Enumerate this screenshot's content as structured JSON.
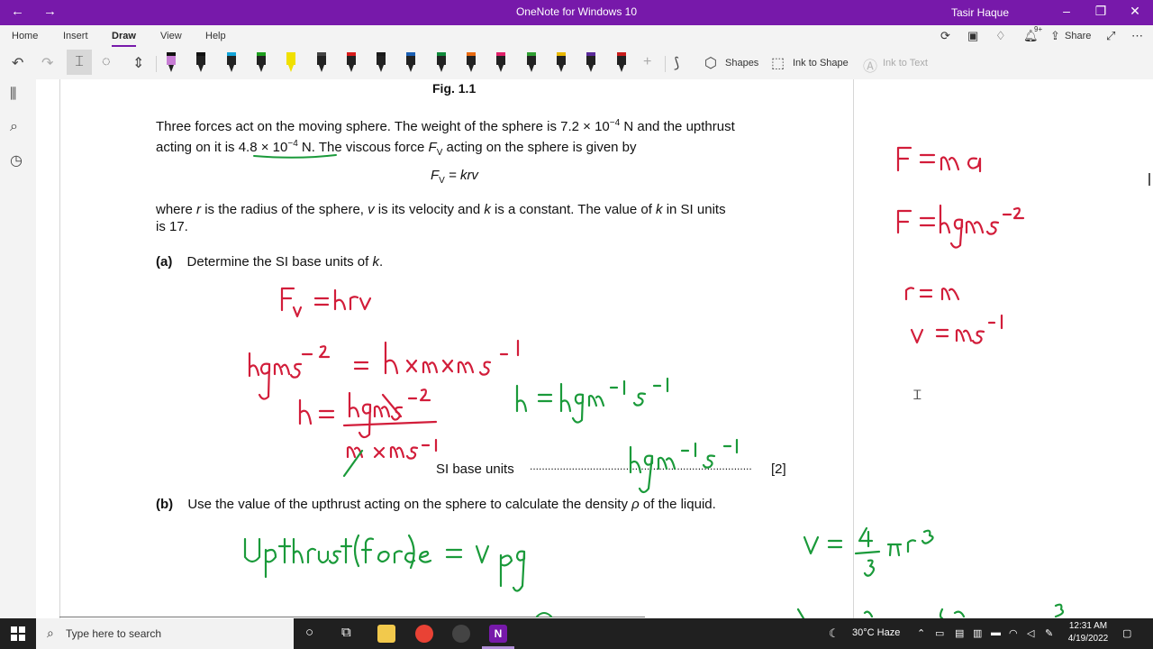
{
  "window": {
    "title": "OneNote for Windows 10",
    "user": "Tasir Haque",
    "back_icon": "←",
    "forward_icon": "→",
    "minimize": "–",
    "restore": "❐",
    "close": "✕"
  },
  "ribbon": {
    "tabs": [
      "Home",
      "Insert",
      "Draw",
      "View",
      "Help"
    ],
    "active_tab": "Draw",
    "share_label": "Share",
    "notification_badge": "9+"
  },
  "draw_tools": {
    "shapes_label": "Shapes",
    "ink_to_shape_label": "Ink to Shape",
    "ink_to_text_label": "Ink to Text",
    "pen_colors": [
      "#111111",
      "#111111",
      "#12a4d8",
      "#1ea01e",
      "#f0e000",
      "#444444",
      "#d81b1b",
      "#1a1a1a",
      "#1a5fb4",
      "#0f8a3a",
      "#e86a10",
      "#e0206a",
      "#2fa032",
      "#e8b800",
      "#5a2a9a",
      "#c81c1c"
    ]
  },
  "document": {
    "fig_caption": "Fig. 1.1",
    "para1_line1": "Three forces act on the moving sphere. The weight of the sphere is 7.2 × 10",
    "para1_line1_exp": "−4",
    "para1_line1_end": " N and the upthrust",
    "para1_line2_a": "acting on it is 4.8 × 10",
    "para1_line2_exp": "−4",
    "para1_line2_b": " N. The viscous force ",
    "para1_line2_f": "F",
    "para1_line2_sub": "V",
    "para1_line2_c": " acting on the sphere is given by",
    "formula_f": "F",
    "formula_sub": "V",
    "formula_rest": " = krv",
    "para2_a": "where ",
    "para2_r": "r",
    "para2_b": " is the radius of the sphere, ",
    "para2_v": "v",
    "para2_c": " is its velocity and ",
    "para2_k": "k",
    "para2_d": " is a constant. The value of ",
    "para2_k2": "k",
    "para2_e": " in SI units",
    "para2_line2": "is 17.",
    "qa_label": "(a)",
    "qa_text": "Determine the SI base units of ",
    "qa_k": "k",
    "qa_end": ".",
    "si_units_label": "SI base units",
    "si_units_dots": "..........................................................................",
    "marks": "[2]",
    "qb_label": "(b)",
    "qb_text_a": "Use the value of the upthrust acting on the sphere to calculate the density ",
    "qb_rho": "ρ",
    "qb_text_b": " of the liquid."
  },
  "taskbar": {
    "search_placeholder": "Type here to search",
    "weather": "30°C  Haze",
    "time": "12:31 AM",
    "date": "4/19/2022",
    "app_colors": {
      "explorer": "#f2c94c",
      "chrome": "#e94235",
      "obs": "#444444",
      "onenote": "#7719aa"
    }
  }
}
